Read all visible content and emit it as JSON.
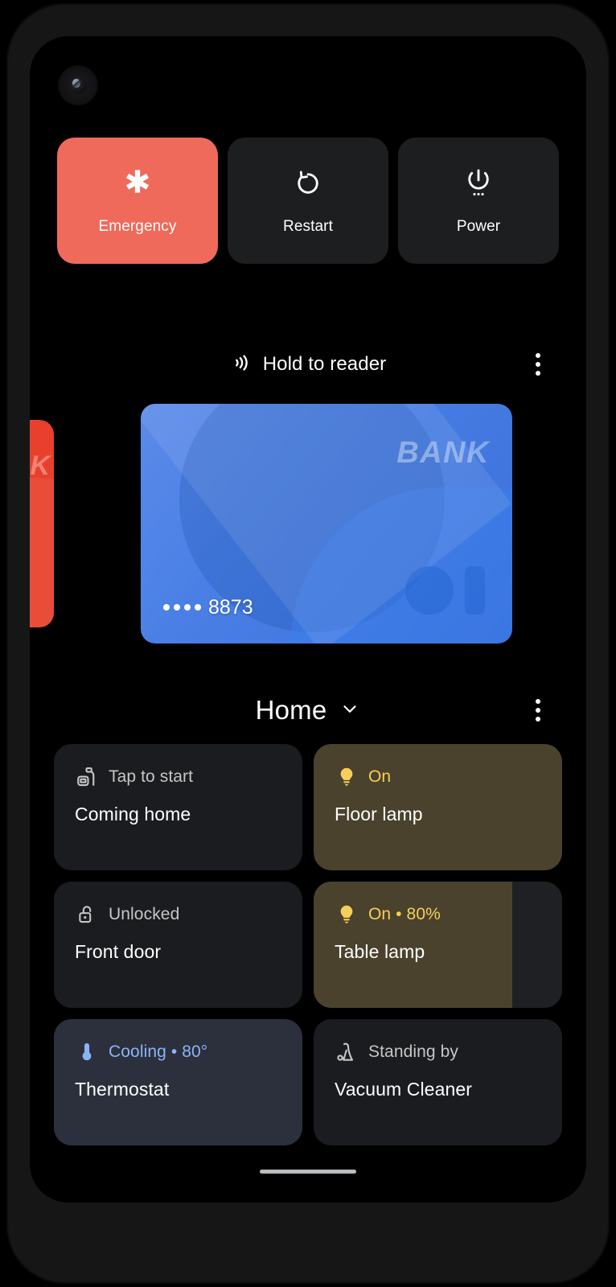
{
  "device": {
    "camera_icon": "front-camera-icon",
    "gesture_pill": "home-gesture-pill"
  },
  "power_actions": [
    {
      "id": "emergency",
      "label": "Emergency",
      "icon": "star-of-life-icon",
      "accent": "#ef6a5a",
      "active": true
    },
    {
      "id": "restart",
      "label": "Restart",
      "icon": "restart-icon",
      "accent": "#1d1e20",
      "active": false
    },
    {
      "id": "power",
      "label": "Power",
      "icon": "power-icon",
      "accent": "#1d1e20",
      "active": false
    }
  ],
  "wallet": {
    "nfc_icon": "nfc-contactless-icon",
    "hint": "Hold to reader",
    "overflow_icon": "overflow-menu-icon",
    "cards": [
      {
        "id": "card-prev",
        "brand": "BANK",
        "brand_partial": "NK",
        "color": "#e8402c",
        "active": false
      },
      {
        "id": "card-active",
        "brand": "BANK",
        "masked_number": "8873",
        "mask_dots": 4,
        "color": "#4a80e6",
        "active": true
      }
    ]
  },
  "home": {
    "title": "Home",
    "chevron_icon": "chevron-down-icon",
    "overflow_icon": "overflow-menu-icon",
    "tiles": [
      {
        "id": "coming-home",
        "name": "Coming home",
        "status": "Tap to start",
        "icon": "routine-home-icon",
        "state": "off",
        "fill_percent": 0
      },
      {
        "id": "floor-lamp",
        "name": "Floor lamp",
        "status": "On",
        "icon": "lightbulb-icon",
        "state": "on",
        "fill_percent": 100
      },
      {
        "id": "front-door",
        "name": "Front door",
        "status": "Unlocked",
        "icon": "unlock-icon",
        "state": "off",
        "fill_percent": 0
      },
      {
        "id": "table-lamp",
        "name": "Table lamp",
        "status": "On • 80%",
        "icon": "lightbulb-icon",
        "state": "dimmer",
        "fill_percent": 80
      },
      {
        "id": "thermostat",
        "name": "Thermostat",
        "status": "Cooling • 80°",
        "icon": "thermometer-icon",
        "state": "cool",
        "fill_percent": 100
      },
      {
        "id": "vacuum-cleaner",
        "name": "Vacuum Cleaner",
        "status": "Standing by",
        "icon": "vacuum-icon",
        "state": "off",
        "fill_percent": 0
      }
    ]
  },
  "colors": {
    "emergency": "#ef6a5a",
    "tile_off": "#1b1c1f",
    "tile_on": "#4a422c",
    "tile_cool": "#2b303c",
    "accent_yellow": "#f5cf5a",
    "accent_blue": "#8ab4f8",
    "card_blue": "#4a80e6",
    "card_red": "#e8402c",
    "screen_bg": "#000000"
  }
}
